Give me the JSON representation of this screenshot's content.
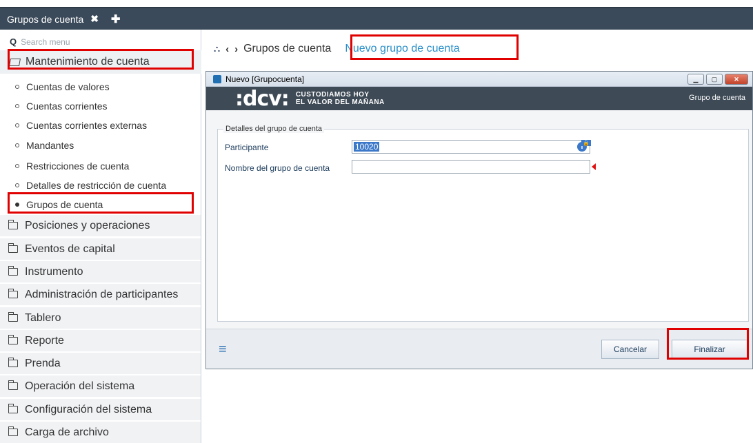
{
  "tabs": [
    {
      "label": "Grupos de cuenta"
    }
  ],
  "sidebar": {
    "search_placeholder": "Search menu",
    "open_group": "Mantenimiento de cuenta",
    "subitems": [
      "Cuentas de valores",
      "Cuentas corrientes",
      "Cuentas corrientes externas",
      "Mandantes",
      "Restricciones de cuenta",
      "Detalles de restricción de cuenta",
      "Grupos de cuenta"
    ],
    "folders": [
      "Posiciones y operaciones",
      "Eventos de capital",
      "Instrumento",
      "Administración de participantes",
      "Tablero",
      "Reporte",
      "Prenda",
      "Operación del sistema",
      "Configuración del sistema",
      "Carga de archivo"
    ]
  },
  "breadcrumb": {
    "parent": "Grupos de cuenta",
    "current": "Nuevo grupo de cuenta"
  },
  "dialog": {
    "title": "Nuevo [Grupocuenta]",
    "logo": ":dcv:",
    "slogan_line1": "CUSTODIAMOS HOY",
    "slogan_line2": "EL VALOR DEL MAÑANA",
    "banner_right": "Grupo de cuenta",
    "fieldset_legend": "Detalles del grupo de cuenta",
    "participante_label": "Participante",
    "participante_value": "10020",
    "nombre_label": "Nombre del grupo de cuenta",
    "nombre_value": "",
    "cancel_label": "Cancelar",
    "finish_label": "Finalizar"
  },
  "colors": {
    "accent": "#2a8fc9",
    "highlight": "#e00000",
    "tabbar": "#3b4a5a",
    "banner": "#3e4a56"
  }
}
